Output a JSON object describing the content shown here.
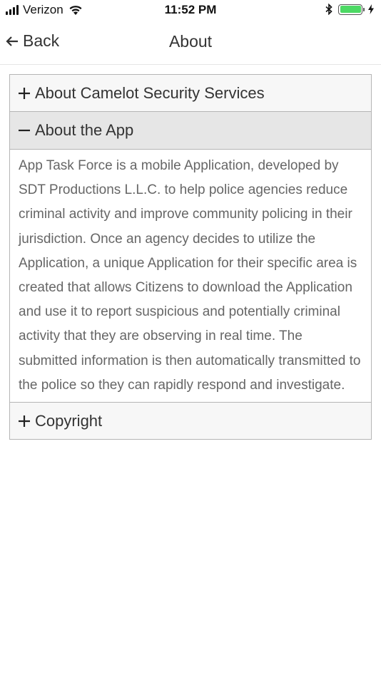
{
  "status_bar": {
    "carrier": "Verizon",
    "time": "11:52 PM",
    "battery_color": "#4cd964"
  },
  "nav": {
    "back_label": "Back",
    "title": "About"
  },
  "accordion": {
    "sections": [
      {
        "label": "About Camelot Security Services",
        "expanded": false
      },
      {
        "label": "About the App",
        "expanded": true,
        "body": "App Task Force is a mobile Application, developed by SDT Productions L.L.C. to help police agencies reduce criminal activity and improve community policing in their jurisdiction. Once an agency decides to utilize the Application, a unique Application for their specific area is created that allows Citizens to download the Application and use it to report suspicious and potentially criminal activity that they are observing in real time. The submitted information is then automatically transmitted to the police so they can rapidly respond and investigate."
      },
      {
        "label": "Copyright",
        "expanded": false
      }
    ]
  },
  "icons": {
    "expand": "plus-icon",
    "collapse": "minus-icon",
    "back": "arrow-left-icon"
  }
}
